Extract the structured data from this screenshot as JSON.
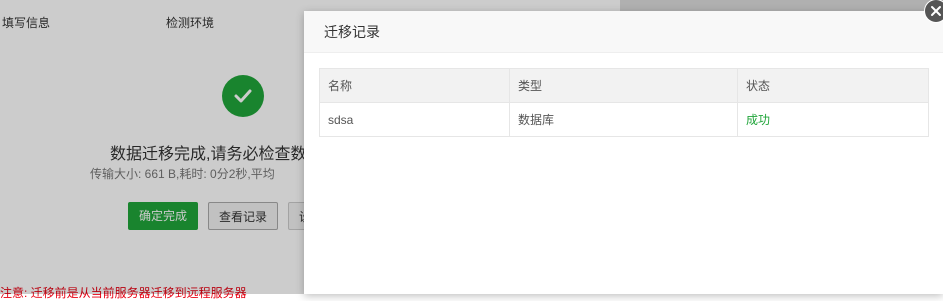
{
  "background": {
    "steps": [
      "填写信息",
      "检测环境"
    ],
    "main_message": "数据迁移完成,请务必检查数",
    "sub_message": "传输大小: 661 B,耗时: 0分2秒,平均",
    "buttons": {
      "confirm": "确定完成",
      "view_record": "查看记录",
      "extra": "设"
    },
    "notice": "注意: 迁移前是从当前服务器迁移到远程服务器"
  },
  "dialog": {
    "title": "迁移记录",
    "table": {
      "headers": [
        "名称",
        "类型",
        "状态"
      ],
      "rows": [
        {
          "name": "sdsa",
          "type": "数据库",
          "status": "成功"
        }
      ]
    }
  },
  "colors": {
    "success": "#20a53a",
    "notice": "#e60012"
  },
  "icons": {
    "success": "check-circle-icon",
    "close": "close-icon"
  }
}
